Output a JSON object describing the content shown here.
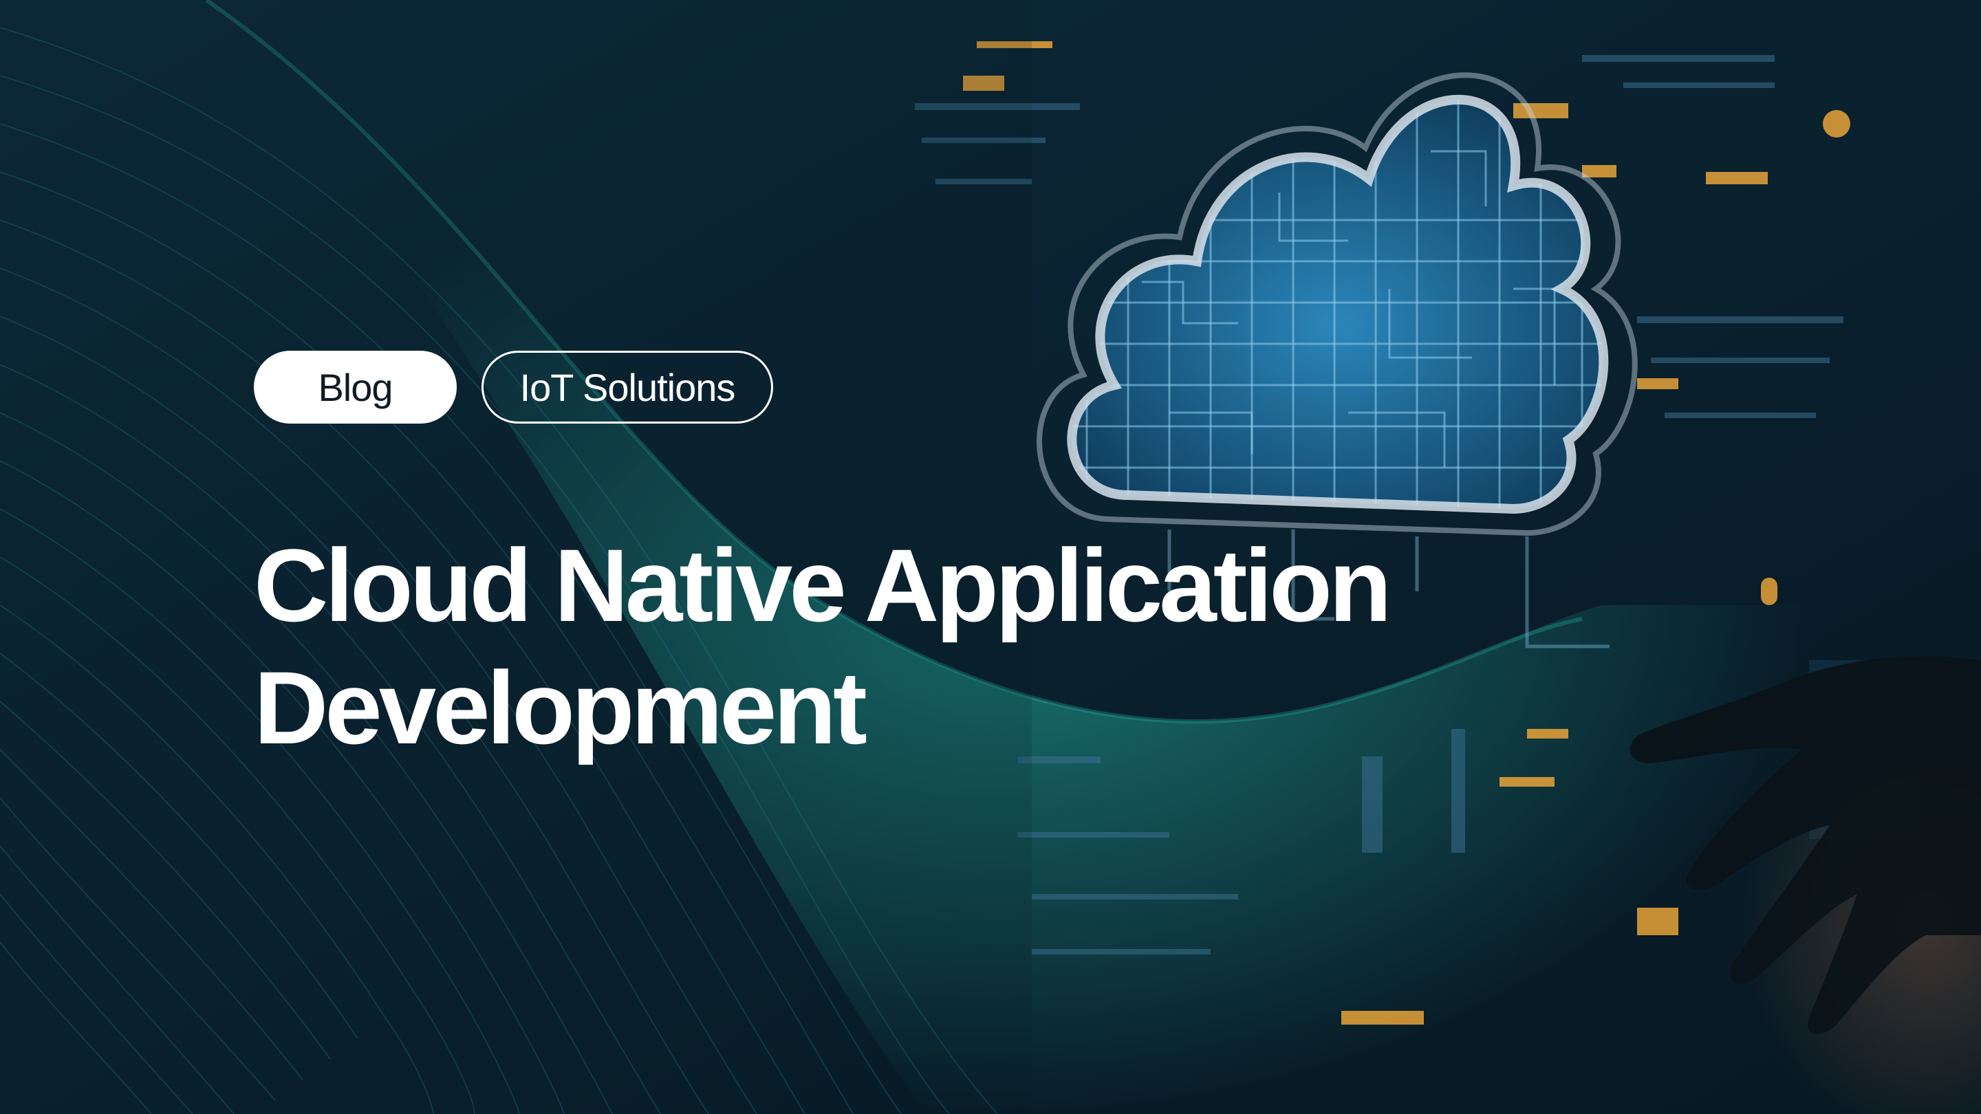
{
  "tags": [
    {
      "label": "Blog"
    },
    {
      "label": "IoT Solutions"
    }
  ],
  "title": {
    "line1": "Cloud Native Application",
    "line2": "Development"
  },
  "colors": {
    "background": "#0b1f2c",
    "accent_teal": "#1fa59a",
    "cloud_blue": "#2f8fc4",
    "highlight_amber": "#e8a33a",
    "text": "#ffffff"
  },
  "icons": {
    "cloud": "cloud-circuit-icon",
    "hand": "hand-icon"
  }
}
